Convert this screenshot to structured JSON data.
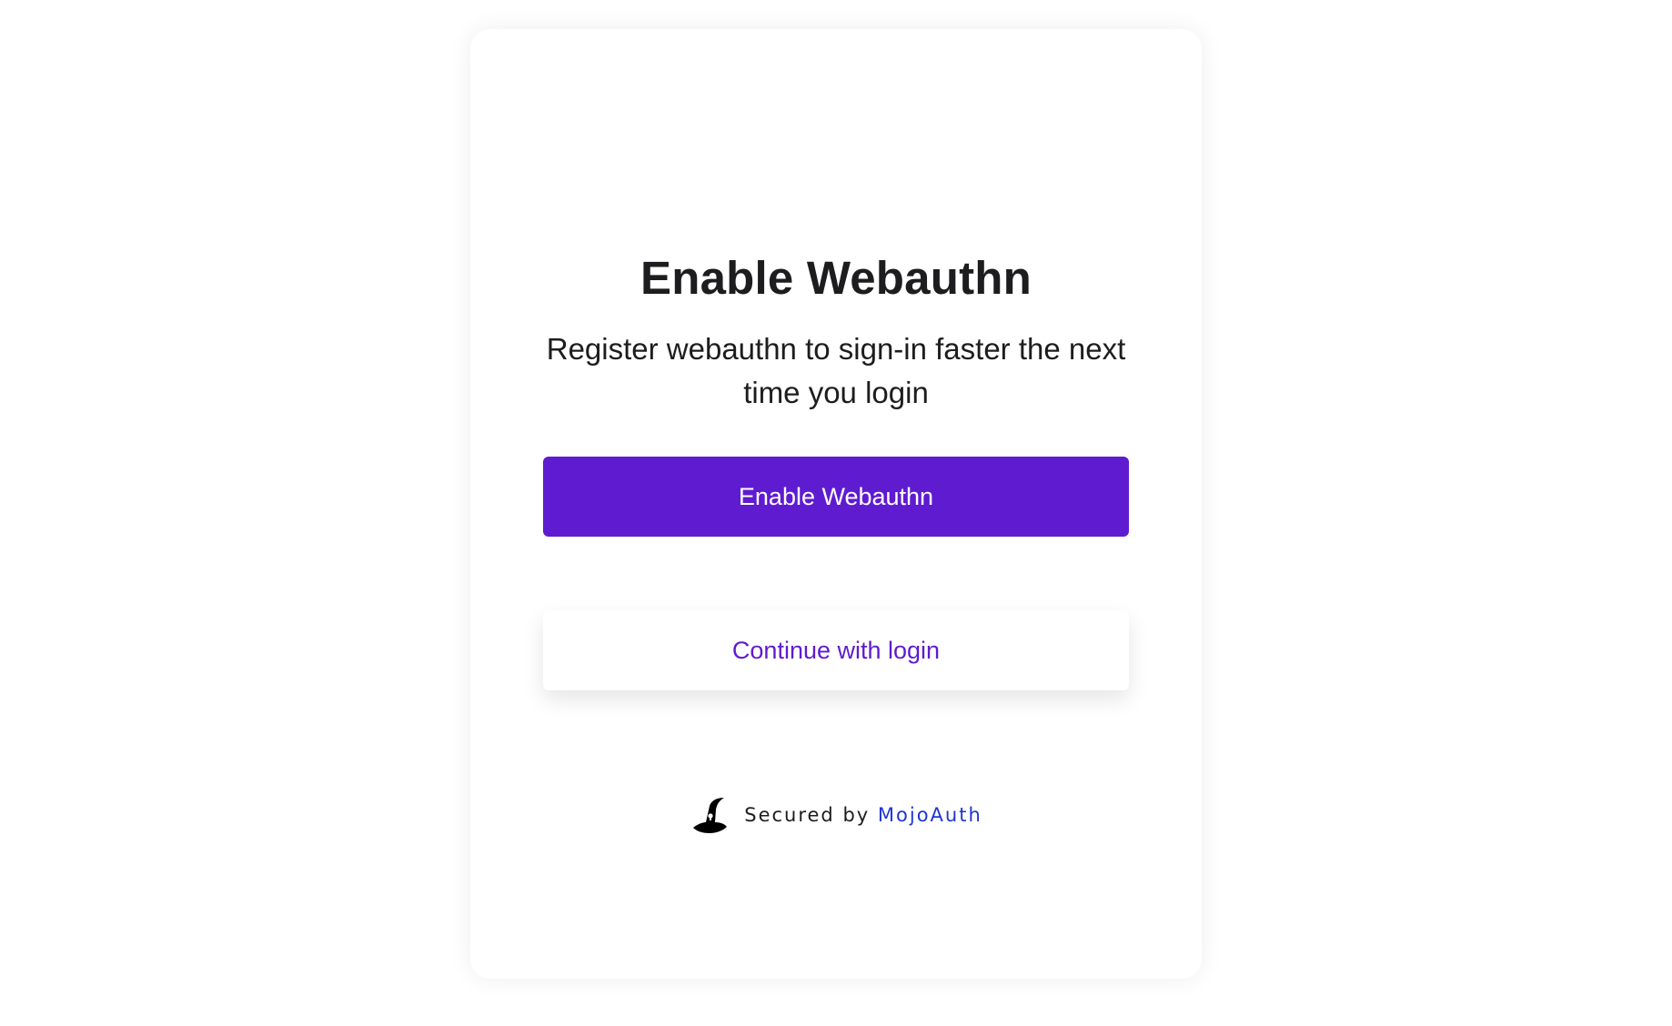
{
  "card": {
    "title": "Enable Webauthn",
    "subtitle": "Register webauthn to sign-in faster the next time you login",
    "primary_button_label": "Enable Webauthn",
    "secondary_button_label": "Continue with login"
  },
  "footer": {
    "secured_by_text": "Secured by",
    "brand_link_text": "MojoAuth",
    "logo_icon": "wizard-hat-icon"
  },
  "colors": {
    "accent": "#5f1bd0",
    "link": "#1f35d6",
    "text": "#1d1d1f"
  }
}
